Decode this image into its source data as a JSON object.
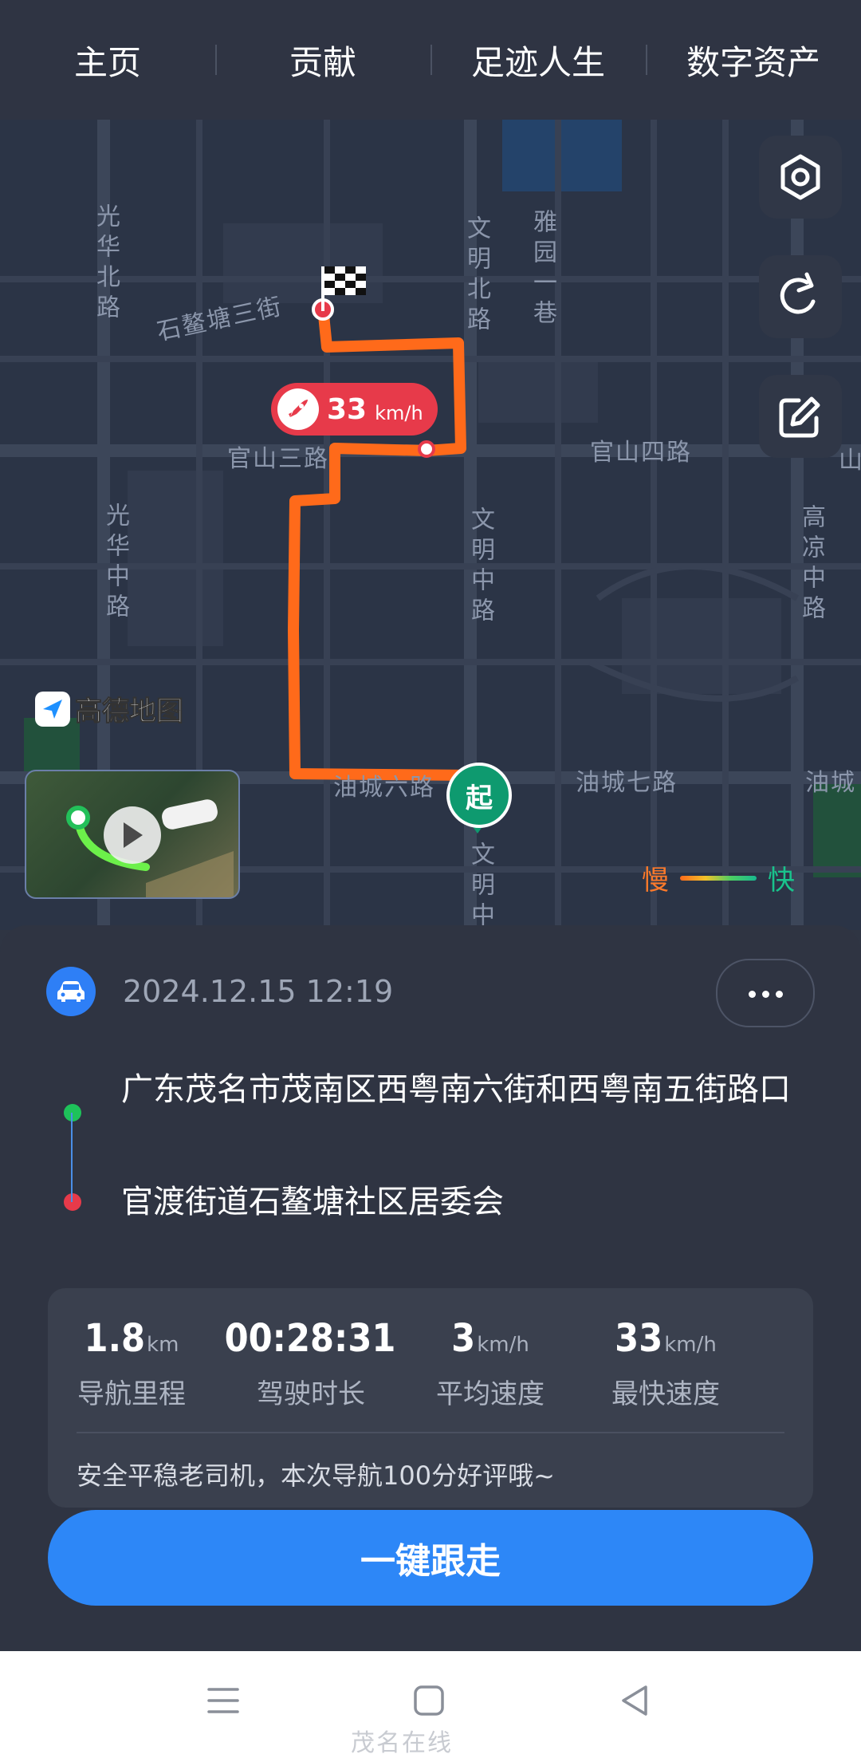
{
  "tabs": [
    "主页",
    "贡献",
    "足迹人生",
    "数字资产"
  ],
  "map": {
    "road_labels": {
      "guanghua_north": "光华北路",
      "shiaotang_3": "石鳌塘三街",
      "wenming_north": "文明北路",
      "yayuan_1": "雅园一巷",
      "guanshan_3": "官山三路",
      "guanshan_4": "官山四路",
      "guanghua_mid": "光华中路",
      "wenming_mid": "文明中路",
      "gaoliang_mid": "高凉中路",
      "youcheng_6": "油城六路",
      "youcheng_7": "油城七路",
      "youcheng": "油城",
      "wenming_mid2": "文明中路",
      "edge_right": "山"
    },
    "brand": "高德地图",
    "speed_tag": {
      "value": "33",
      "unit": "km/h"
    },
    "start_label": "起",
    "legend": {
      "slow": "慢",
      "fast": "快"
    },
    "buttons": [
      "settings-icon",
      "share-icon",
      "edit-icon"
    ],
    "route_color": "#ff6a1a"
  },
  "trip": {
    "datetime": "2024.12.15 12:19",
    "from": "广东茂名市茂南区西粤南六街和西粤南五街路口",
    "to": "官渡街道石鳌塘社区居委会",
    "stats": [
      {
        "value": "1.8",
        "unit": "km",
        "label": "导航里程"
      },
      {
        "value": "00:28:31",
        "unit": "",
        "label": "驾驶时长"
      },
      {
        "value": "3",
        "unit": "km/h",
        "label": "平均速度"
      },
      {
        "value": "33",
        "unit": "km/h",
        "label": "最快速度"
      }
    ],
    "comment": "安全平稳老司机，本次导航100分好评哦~",
    "follow_button": "一键跟走"
  },
  "navbar": [
    "menu-icon",
    "home-icon",
    "back-icon"
  ],
  "watermark": "茂名在线"
}
